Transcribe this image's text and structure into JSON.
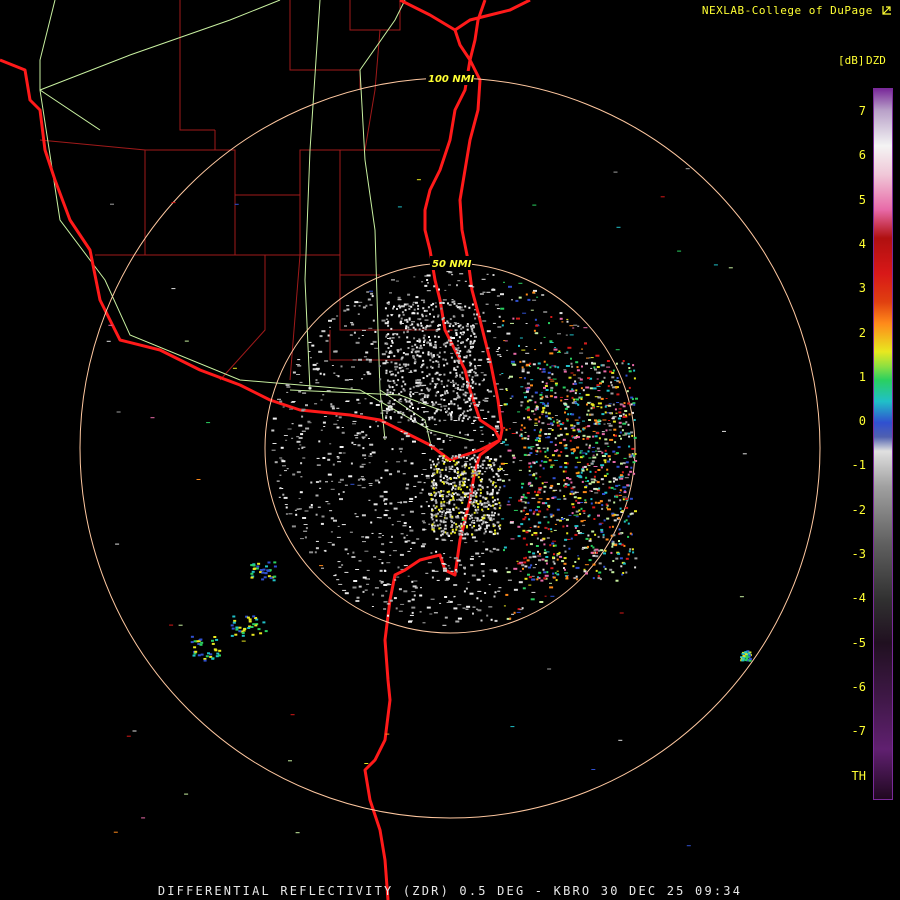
{
  "credit": "NEXLAB-College of DuPage",
  "footer": "DIFFERENTIAL REFLECTIVITY (ZDR) 0.5 DEG - KBRO 30 DEC 25 09:34",
  "radar": {
    "site": "KBRO",
    "product": "DIFFERENTIAL REFLECTIVITY (ZDR)",
    "elevation": "0.5 DEG",
    "date": "30 DEC 25",
    "time": "09:34"
  },
  "range_rings": [
    {
      "label": "50 NMI",
      "nmi": 50
    },
    {
      "label": "100 NMI",
      "nmi": 100
    }
  ],
  "legend": {
    "title": "DZD",
    "unit": "[dB]",
    "ticks": [
      "7",
      "6",
      "5",
      "4",
      "3",
      "2",
      "1",
      "0",
      "-1",
      "-2",
      "-3",
      "-4",
      "-5",
      "-6",
      "-7",
      "TH"
    ],
    "colors": {
      "purple_top": "#7a2a9a",
      "white": "#f4f4f4",
      "pink": "#e86aa8",
      "red": "#d81818",
      "orange": "#ff8a1a",
      "yellow": "#e8e820",
      "green": "#2ad060",
      "cyan": "#20c0c8",
      "blue": "#3050d0",
      "gray": "#a0a0a0",
      "dark_purple": "#401848"
    }
  },
  "map_colors": {
    "background": "#000000",
    "border": "#ff1a1a",
    "county": "#a01a1a",
    "highway": "#c8f0a0",
    "ring": "#ffc8a0",
    "ring_label": "#ffff33"
  },
  "icons": {
    "credit_logo": "nexlab-arrow-icon"
  }
}
